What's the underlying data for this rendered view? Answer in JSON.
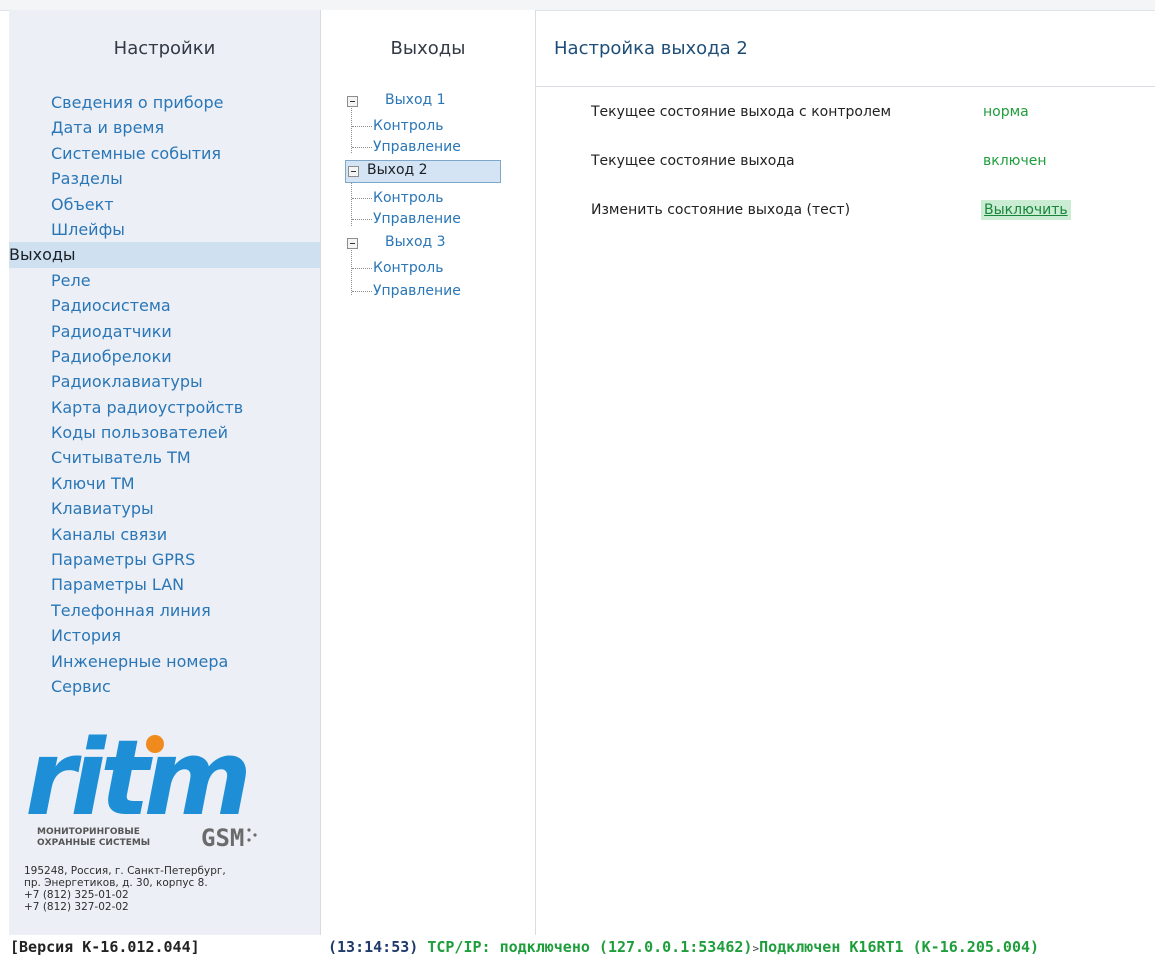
{
  "sidebar": {
    "title": "Настройки",
    "items": [
      {
        "label": "Сведения о приборе"
      },
      {
        "label": "Дата и время"
      },
      {
        "label": "Системные события"
      },
      {
        "label": "Разделы"
      },
      {
        "label": "Объект"
      },
      {
        "label": "Шлейфы"
      },
      {
        "label": "Выходы",
        "active": true
      },
      {
        "label": "Реле"
      },
      {
        "label": "Радиосистема"
      },
      {
        "label": "Радиодатчики"
      },
      {
        "label": "Радиобрелоки"
      },
      {
        "label": "Радиоклавиатуры"
      },
      {
        "label": "Карта радиоустройств"
      },
      {
        "label": "Коды пользователей"
      },
      {
        "label": "Считыватель ТМ"
      },
      {
        "label": "Ключи ТМ"
      },
      {
        "label": "Клавиатуры"
      },
      {
        "label": "Каналы связи"
      },
      {
        "label": "Параметры GPRS"
      },
      {
        "label": "Параметры LAN"
      },
      {
        "label": "Телефонная линия"
      },
      {
        "label": "История"
      },
      {
        "label": "Инженерные номера"
      },
      {
        "label": "Сервис"
      }
    ],
    "logo": {
      "word": "ritm",
      "tagline_line1": "МОНИТОРИНГОВЫЕ",
      "tagline_line2": "ОХРАННЫЕ СИСТЕМЫ",
      "gsm": "GSM",
      "blue": "#1e8fd6",
      "orange": "#f08a1d"
    },
    "address": {
      "line1": "195248, Россия, г. Санкт-Петербург,",
      "line2": "пр. Энергетиков, д. 30, корпус 8.",
      "phone1": "+7 (812) 325-01-02",
      "phone2": "+7 (812) 327-02-02"
    }
  },
  "tree": {
    "title": "Выходы",
    "nodes": [
      {
        "label": "Выход 1",
        "children": [
          "Контроль",
          "Управление"
        ]
      },
      {
        "label": "Выход 2",
        "selected": true,
        "children": [
          "Контроль",
          "Управление"
        ]
      },
      {
        "label": "Выход 3",
        "children": [
          "Контроль",
          "Управление"
        ]
      }
    ]
  },
  "main": {
    "title": "Настройка выхода 2",
    "rows": [
      {
        "label": "Текущее состояние выхода с контролем",
        "value": "норма"
      },
      {
        "label": "Текущее состояние выхода",
        "value": "включен"
      },
      {
        "label": "Изменить состояние выхода (тест)",
        "button": "Выключить"
      }
    ]
  },
  "status": {
    "version": "[Версия К-16.012.044]",
    "time": "(13:14:53)",
    "tcp": "TCP/IP: подключено (127.0.0.1:53462)",
    "arrow": ">",
    "device": "Подключен К16RT1 (К-16.205.004)"
  },
  "colors": {
    "link": "#2a76b6",
    "ok_green": "#1f9e3c",
    "active_bg": "#cfe0f1"
  }
}
